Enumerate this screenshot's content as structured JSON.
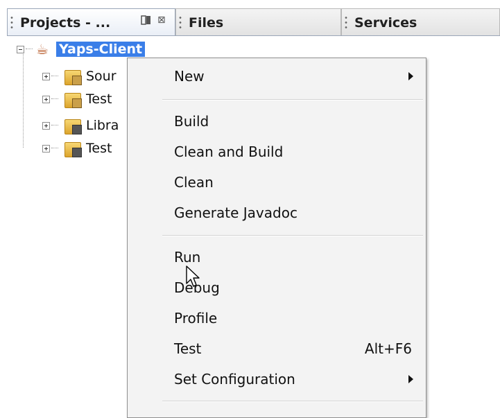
{
  "tabs": [
    {
      "label": "Projects - ...",
      "active": true
    },
    {
      "label": "Files",
      "active": false
    },
    {
      "label": "Services",
      "active": false
    }
  ],
  "tab_buttons": {
    "minimize_icon": "minimize-window-icon",
    "close_glyph": "⊠"
  },
  "tree": {
    "root": {
      "label": "Yaps-Client",
      "icon": "java-project-cup-icon",
      "expanded": true,
      "selected": true
    },
    "children": [
      {
        "label": "Sour",
        "icon": "source-packages-folder-icon"
      },
      {
        "label": "Test",
        "icon": "test-packages-folder-icon"
      },
      {
        "label": "Libra",
        "icon": "libraries-folder-icon"
      },
      {
        "label": "Test",
        "icon": "test-libraries-folder-icon"
      }
    ]
  },
  "context_menu": {
    "groups": [
      [
        {
          "label": "New",
          "submenu": true
        }
      ],
      [
        {
          "label": "Build"
        },
        {
          "label": "Clean and Build"
        },
        {
          "label": "Clean"
        },
        {
          "label": "Generate Javadoc"
        }
      ],
      [
        {
          "label": "Run"
        },
        {
          "label": "Debug"
        },
        {
          "label": "Profile"
        },
        {
          "label": "Test",
          "shortcut": "Alt+F6"
        },
        {
          "label": "Set Configuration",
          "submenu": true
        }
      ]
    ]
  },
  "colors": {
    "selection": "#3a7ee8",
    "menu_bg": "#f3f3f3",
    "accent_border": "#9aa6b8"
  }
}
